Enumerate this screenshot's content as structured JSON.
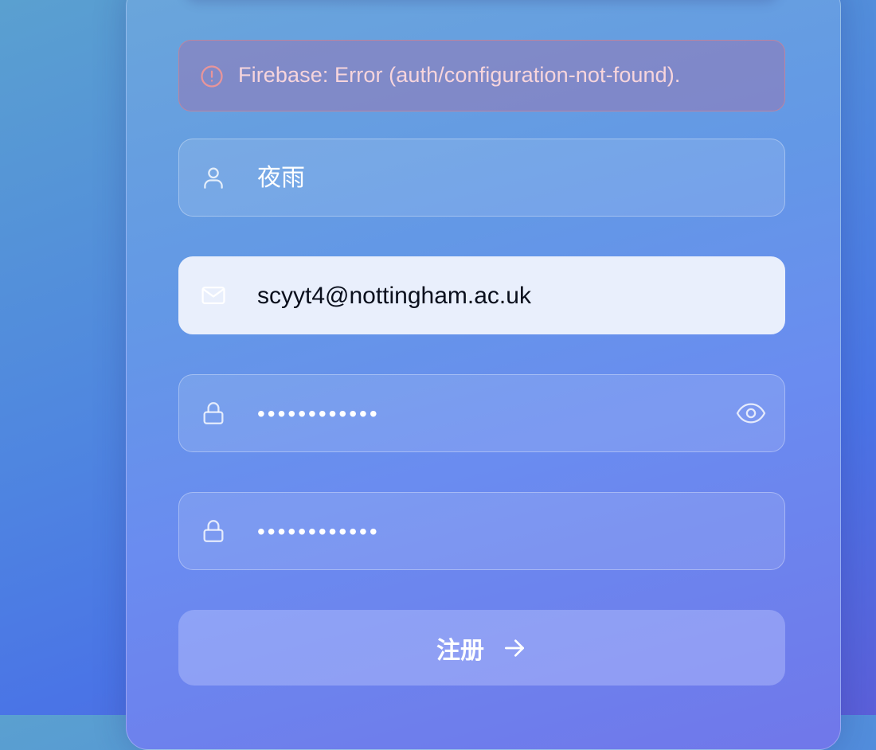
{
  "error": {
    "message": "Firebase: Error (auth/configuration-not-found).",
    "icon": "alert-circle-icon"
  },
  "form": {
    "username": {
      "value": "夜雨",
      "icon": "user-icon"
    },
    "email": {
      "value": "scyyt4@nottingham.ac.uk",
      "icon": "mail-icon"
    },
    "password": {
      "masked": "••••••••••••",
      "icon": "lock-icon",
      "toggle_icon": "eye-icon"
    },
    "confirm_password": {
      "masked": "••••••••••••",
      "icon": "lock-icon"
    },
    "submit": {
      "label": "注册",
      "icon": "arrow-right-icon"
    }
  },
  "colors": {
    "error_text": "#f7d5dc",
    "error_border": "#dc828c",
    "focused_field_bg": "#e9effc"
  }
}
